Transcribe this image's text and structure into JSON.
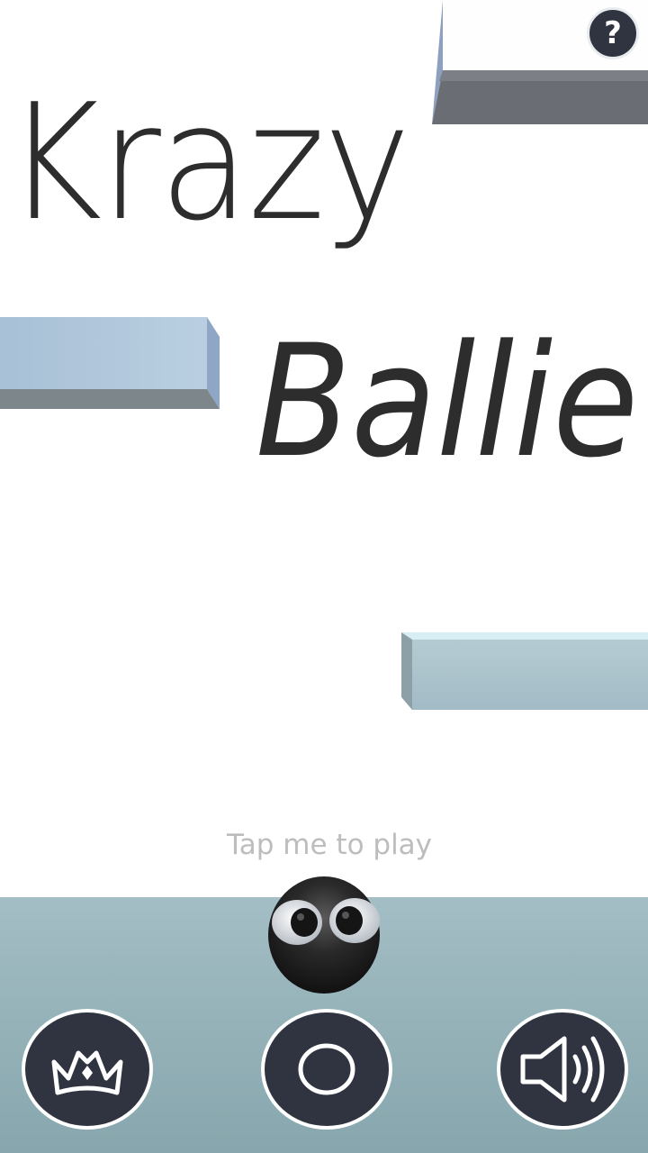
{
  "game": {
    "title_line1": "Krazy",
    "title_line2": "Ballie",
    "tap_hint": "Tap me to play",
    "help_label": "?"
  },
  "buttons": {
    "leaderboard_icon": "crown-icon",
    "play_icon": "circle-icon",
    "sound_icon": "speaker-icon"
  },
  "colors": {
    "title_text": "#2d2d2d",
    "button_fill": "#2f3440",
    "button_ring": "#ffffff",
    "floor": "#93b0b7",
    "platform": "#b8cbd8",
    "hint_text": "#bdbdbd"
  }
}
